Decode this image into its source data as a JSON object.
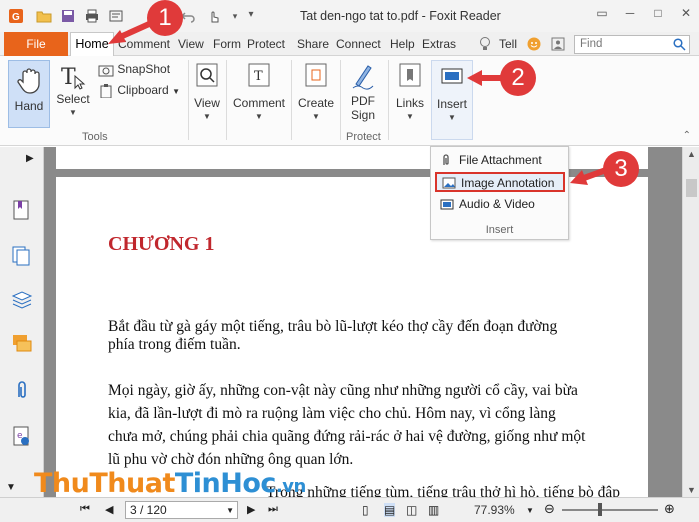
{
  "window": {
    "title": "Tat den-ngo tat to.pdf - Foxit Reader"
  },
  "menubar": {
    "file": "File",
    "items": [
      "Home",
      "Comment",
      "View",
      "Form",
      "Protect",
      "Share",
      "Connect",
      "Help",
      "Extras"
    ],
    "tell": "Tell",
    "find_placeholder": "Find"
  },
  "ribbon": {
    "hand": "Hand",
    "select": "Select",
    "snapshot": "SnapShot",
    "clipboard": "Clipboard",
    "tools_group": "Tools",
    "view": "View",
    "comment": "Comment",
    "create": "Create",
    "pdf_sign": "PDF\nSign",
    "protect_group": "Protect",
    "links": "Links",
    "insert": "Insert"
  },
  "insert_menu": {
    "items": [
      "File Attachment",
      "Image Annotation",
      "Audio & Video"
    ],
    "selected": "Image Annotation",
    "group": "Insert"
  },
  "document": {
    "heading": "CHƯƠNG 1",
    "para1": [
      "Bắt đầu từ gà gáy một tiếng, trâu bò lũ-lượt kéo thợ cầy đến đoạn đường",
      "phía trong điếm tuần."
    ],
    "para2": [
      "Mọi ngày, giờ ấy, những con-vật này cũng như những người cổ cầy, vai bừa",
      "kia, đã lần-lượt đi mò ra ruộng làm việc cho chủ. Hôm nay, vì cổng làng",
      "chưa mở, chúng phải chia quãng đứng rải-rác ở hai vệ đường, giống như một",
      "lũ phu vờ chờ đón những ông quan lớn."
    ],
    "partial_line": "Trong những tiếng tùm, tiếng trâu thở hì hò, tiếng bò đập đuôi"
  },
  "statusbar": {
    "page": "3 / 120",
    "zoom": "77.93%"
  },
  "watermark": {
    "part1": "Thu",
    "part2": "Thuat",
    "part3": "Tin",
    "part4": "Hoc",
    "part5": ".vn"
  },
  "callouts": [
    "1",
    "2",
    "3"
  ],
  "colors": {
    "file_tab": "#e8641b",
    "heading": "#c0272d",
    "callout": "#e03a3a",
    "selection_border": "#d9342b"
  }
}
